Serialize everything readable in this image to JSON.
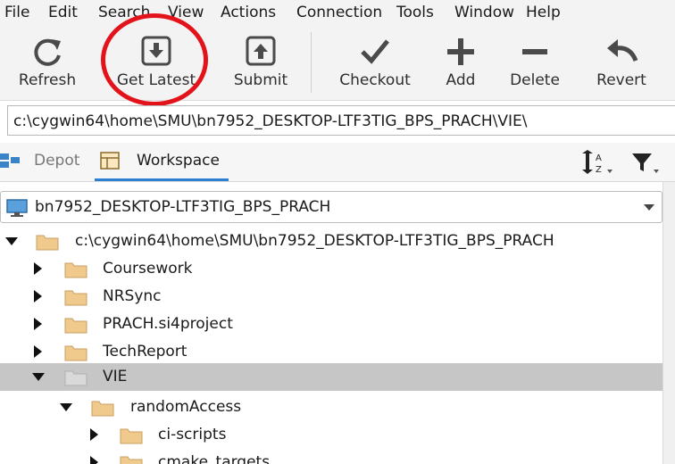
{
  "menu": [
    "File",
    "Edit",
    "Search",
    "View",
    "Actions",
    "Connection",
    "Tools",
    "Window",
    "Help"
  ],
  "toolbar": {
    "refresh": "Refresh",
    "get_latest": "Get Latest",
    "submit": "Submit",
    "checkout": "Checkout",
    "add": "Add",
    "delete": "Delete",
    "revert": "Revert"
  },
  "path": "c:\\cygwin64\\home\\SMU\\bn7952_DESKTOP-LTF3TIG_BPS_PRACH\\VIE\\",
  "tabs": {
    "depot": "Depot",
    "workspace": "Workspace"
  },
  "workspace_select": "bn7952_DESKTOP-LTF3TIG_BPS_PRACH",
  "tree": {
    "root": "c:\\cygwin64\\home\\SMU\\bn7952_DESKTOP-LTF3TIG_BPS_PRACH",
    "coursework": "Coursework",
    "nrsync": "NRSync",
    "prach": "PRACH.si4project",
    "techreport": "TechReport",
    "vie": "VIE",
    "randomaccess": "randomAccess",
    "ciscripts": "ci-scripts",
    "cmake": "cmake_targets"
  },
  "colors": {
    "highlight": "#e3131b",
    "selected_row": "#c6c6c6",
    "folder": "#f0c98c",
    "accent": "#2d7fd2"
  }
}
